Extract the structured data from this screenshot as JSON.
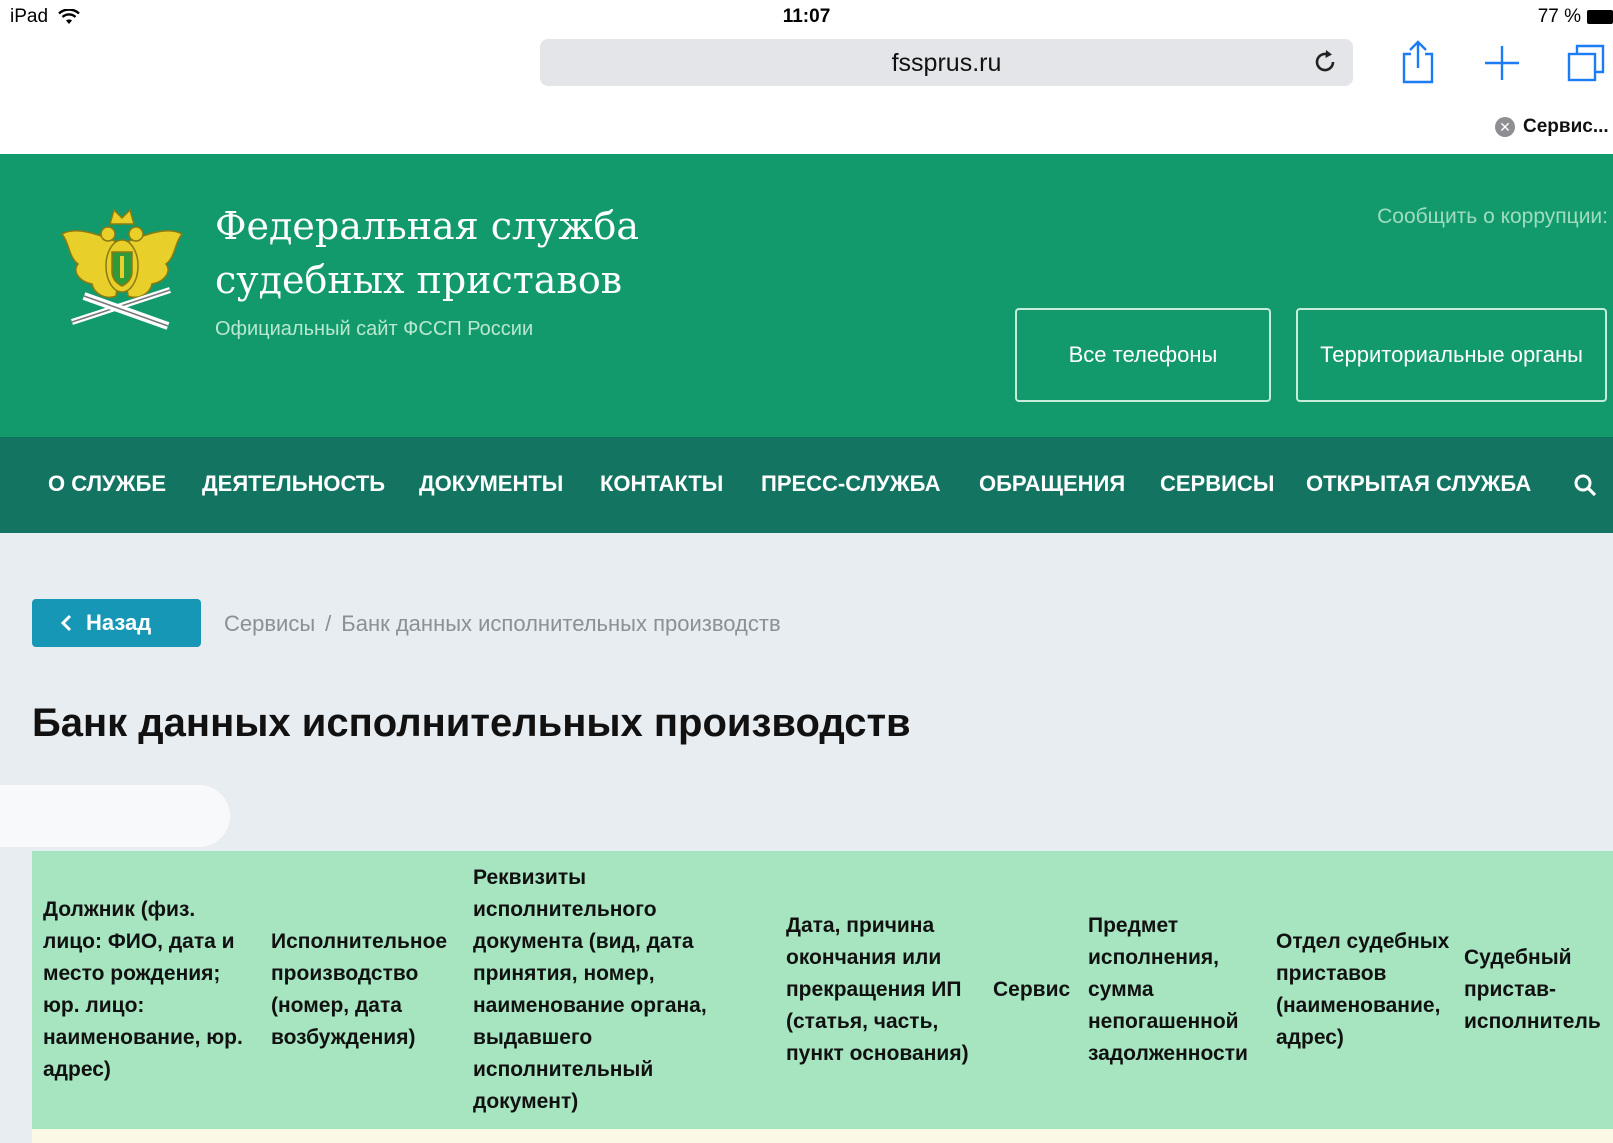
{
  "status_bar": {
    "device": "iPad",
    "time": "11:07",
    "battery": "77 %"
  },
  "browser": {
    "url": "fssprus.ru",
    "tab_label": "Сервис..."
  },
  "header": {
    "title_line1": "Федеральная служба",
    "title_line2": "судебных приставов",
    "subtitle": "Официальный сайт ФССП России",
    "corruption_link": "Сообщить о коррупции:",
    "btn_phones": "Все телефоны",
    "btn_regions": "Территориальные органы"
  },
  "nav": {
    "items": [
      "О СЛУЖБЕ",
      "ДЕЯТЕЛЬНОСТЬ",
      "ДОКУМЕНТЫ",
      "КОНТАКТЫ",
      "ПРЕСС-СЛУЖБА",
      "ОБРАЩЕНИЯ",
      "СЕРВИСЫ",
      "ОТКРЫТАЯ СЛУЖБА"
    ]
  },
  "content": {
    "back_label": "Назад",
    "breadcrumb": [
      "Сервисы",
      "Банк данных исполнительных производств"
    ],
    "page_title": "Банк данных исполнительных производств"
  },
  "table": {
    "headers": [
      "Должник (физ. лицо: ФИО, дата и место рождения; юр. лицо: наименование, юр. адрес)",
      "Исполнительное производство (номер, дата возбуждения)",
      "Реквизиты исполнительного документа (вид, дата принятия, номер, наименование органа, выдавшего исполнительный документ)",
      "Дата, причина окончания или прекращения ИП (статья, часть, пункт основания)",
      "Сервис",
      "Предмет исполнения, сумма непогашенной задолженности",
      "Отдел судебных приставов (наименование, адрес)",
      "Судебный пристав-исполнитель"
    ]
  },
  "colors": {
    "header_green": "#139a6c",
    "nav_green": "#137461",
    "table_head": "#a6e5c0",
    "back_button": "#1797b6"
  }
}
